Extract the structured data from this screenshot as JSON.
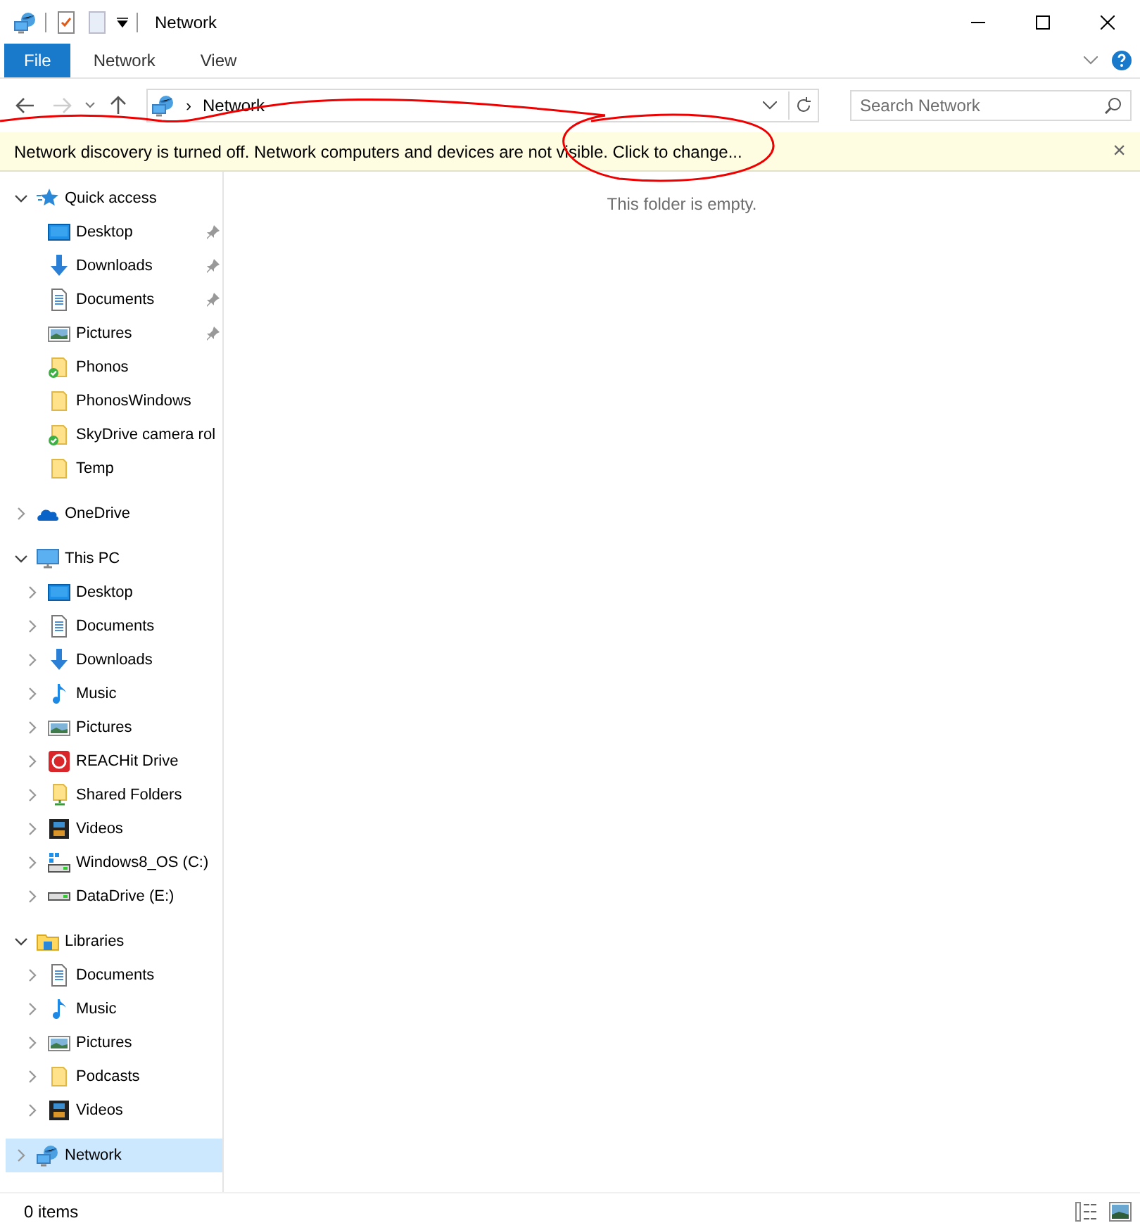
{
  "window": {
    "title": "Network"
  },
  "ribbon_tabs": [
    {
      "label": "File",
      "kind": "file",
      "selected": false
    },
    {
      "label": "Network",
      "kind": "tab",
      "selected": false
    },
    {
      "label": "View",
      "kind": "tab",
      "selected": false
    }
  ],
  "address": {
    "path": "Network",
    "separator": "›"
  },
  "search": {
    "placeholder": "Search Network"
  },
  "info_bar": {
    "message": "Network discovery is turned off. Network computers and devices are not visible. Click to change...",
    "close": "×"
  },
  "sidebar": {
    "items": [
      {
        "label": "Quick access",
        "kind": "star",
        "expanded": true,
        "selected": false,
        "children": [
          {
            "label": "Desktop",
            "kind": "desktop",
            "pinned": true,
            "synced": false,
            "selected": false
          },
          {
            "label": "Downloads",
            "kind": "downloads",
            "pinned": true,
            "synced": false,
            "selected": false
          },
          {
            "label": "Documents",
            "kind": "documents",
            "pinned": true,
            "synced": false,
            "selected": false
          },
          {
            "label": "Pictures",
            "kind": "pictures",
            "pinned": true,
            "synced": false,
            "selected": false
          },
          {
            "label": "Phonos",
            "kind": "folder",
            "pinned": false,
            "synced": true,
            "selected": false
          },
          {
            "label": "PhonosWindows",
            "kind": "folder",
            "pinned": false,
            "synced": false,
            "selected": false
          },
          {
            "label": "SkyDrive camera rol",
            "kind": "folder",
            "pinned": false,
            "synced": true,
            "selected": false
          },
          {
            "label": "Temp",
            "kind": "folder",
            "pinned": false,
            "synced": false,
            "selected": false
          }
        ]
      },
      {
        "label": "OneDrive",
        "kind": "cloud",
        "expanded": false,
        "selected": false
      },
      {
        "label": "This PC",
        "kind": "pc",
        "expanded": true,
        "selected": false,
        "children": [
          {
            "label": "Desktop",
            "kind": "desktop",
            "expanded": false,
            "selected": false
          },
          {
            "label": "Documents",
            "kind": "documents",
            "expanded": false,
            "selected": false
          },
          {
            "label": "Downloads",
            "kind": "downloads",
            "expanded": false,
            "selected": false
          },
          {
            "label": "Music",
            "kind": "music",
            "expanded": false,
            "selected": false
          },
          {
            "label": "Pictures",
            "kind": "pictures",
            "expanded": false,
            "selected": false
          },
          {
            "label": "REACHit Drive",
            "kind": "appdrive",
            "expanded": false,
            "selected": false
          },
          {
            "label": "Shared Folders",
            "kind": "shared",
            "expanded": false,
            "selected": false
          },
          {
            "label": "Videos",
            "kind": "videos",
            "expanded": false,
            "selected": false
          },
          {
            "label": "Windows8_OS (C:)",
            "kind": "sysdrive",
            "expanded": false,
            "selected": false
          },
          {
            "label": "DataDrive (E:)",
            "kind": "drive",
            "expanded": false,
            "selected": false
          }
        ]
      },
      {
        "label": "Libraries",
        "kind": "libraries",
        "expanded": true,
        "selected": false,
        "children": [
          {
            "label": "Documents",
            "kind": "documents",
            "expanded": false,
            "selected": false
          },
          {
            "label": "Music",
            "kind": "music",
            "expanded": false,
            "selected": false
          },
          {
            "label": "Pictures",
            "kind": "pictures",
            "expanded": false,
            "selected": false
          },
          {
            "label": "Podcasts",
            "kind": "folder",
            "expanded": false,
            "selected": false
          },
          {
            "label": "Videos",
            "kind": "videos",
            "expanded": false,
            "selected": false
          }
        ]
      },
      {
        "label": "Network",
        "kind": "network",
        "expanded": false,
        "selected": true
      }
    ]
  },
  "content": {
    "empty_message": "This folder is empty."
  },
  "status_bar": {
    "items": "0 items"
  }
}
